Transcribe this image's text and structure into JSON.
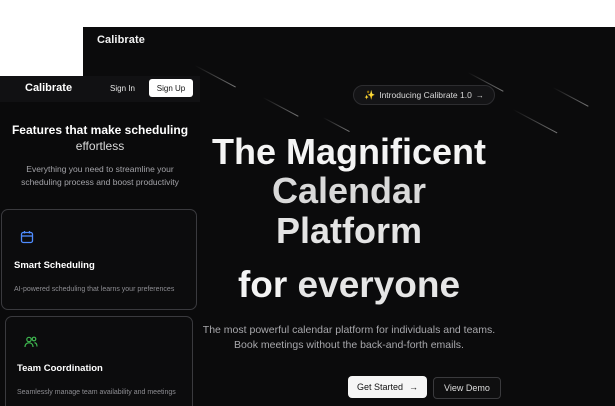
{
  "main": {
    "logo": "Calibrate",
    "intro_pill": {
      "label": "Introducing Calibrate 1.0",
      "icon": "sparkle-icon",
      "arrow": "→"
    },
    "hero": {
      "line1": "The Magnificent",
      "line2": "Calendar",
      "line3": "Platform",
      "line4_a": "for",
      "line4_b": "everyone"
    },
    "subtitle_1": "The most powerful calendar platform for individuals and teams.",
    "subtitle_2": "Book meetings without the back-and-forth emails.",
    "get_started": {
      "label": "Get Started",
      "arrow": "→"
    },
    "view_demo": "View Demo"
  },
  "mobile": {
    "logo": "Calibrate",
    "sign_in": "Sign In",
    "sign_up": "Sign Up",
    "title_1": "Features that make scheduling",
    "title_2": "effortless",
    "desc_1": "Everything you need to streamline your",
    "desc_2": "scheduling process and boost productivity",
    "cards": [
      {
        "icon": "calendar-icon",
        "title": "Smart Scheduling",
        "desc": "AI-powered scheduling that learns your preferences"
      },
      {
        "icon": "users-icon",
        "title": "Team Coordination",
        "desc": "Seamlessly manage team availability and meetings"
      }
    ]
  },
  "colors": {
    "background": "#0b0b0c",
    "accent_blue": "#4f8cff",
    "accent_green": "#3fb950",
    "sparkle": "#f2c94c"
  }
}
